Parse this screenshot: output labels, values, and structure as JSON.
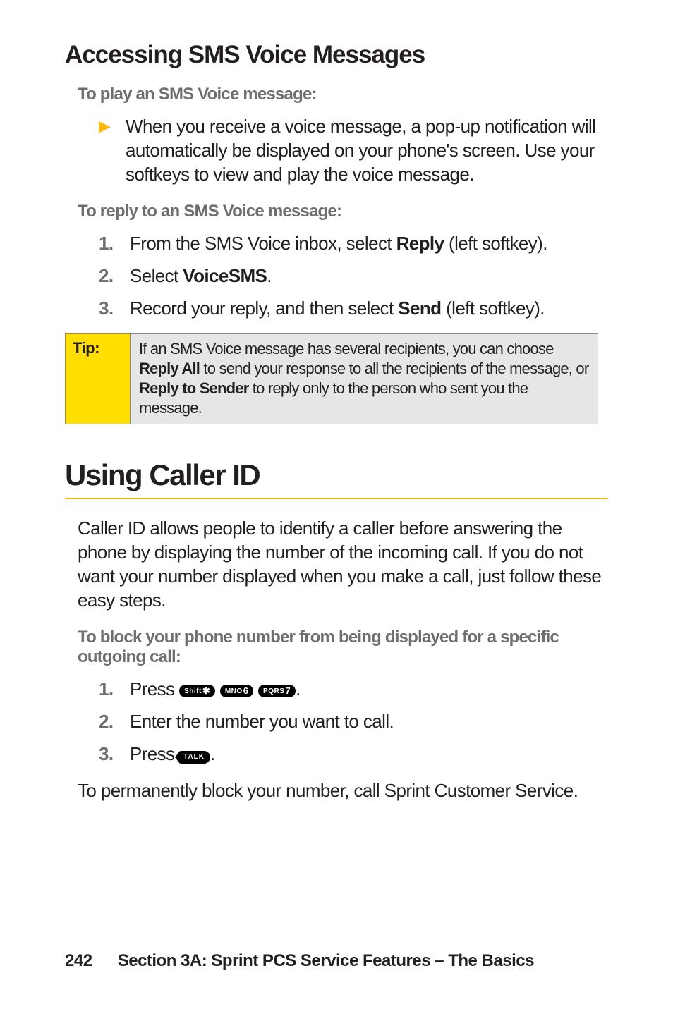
{
  "section1": {
    "heading": "Accessing SMS Voice Messages",
    "lead1": "To play an SMS Voice message:",
    "bullet": "When you receive a voice message, a pop-up notification will automatically be displayed on your phone's screen. Use your softkeys to view and play the voice message.",
    "lead2": "To reply to an SMS Voice message:",
    "step1_pre": "From the SMS Voice inbox, select ",
    "step1_bold": "Reply",
    "step1_post": " (left softkey).",
    "step2_pre": "Select ",
    "step2_bold": "VoiceSMS",
    "step2_post": ".",
    "step3_pre": "Record your reply, and then select ",
    "step3_bold": "Send",
    "step3_post": " (left softkey).",
    "tip_label": "Tip:",
    "tip_pre": "If an SMS Voice message has several recipients, you can choose ",
    "tip_b1": "Reply All",
    "tip_mid": " to send your response to all the recipients of the message, or ",
    "tip_b2": "Reply to Sender",
    "tip_post": " to reply only to the person who sent you the message."
  },
  "section2": {
    "heading": "Using Caller ID",
    "para": "Caller ID allows people to identify a caller before answering the phone by displaying the number of the incoming call. If you do not want your number displayed when you make a call, just follow these easy steps.",
    "lead": "To block your phone number from being displayed for a specific outgoing call:",
    "step1_pre": "Press ",
    "step1_post": ".",
    "step2": "Enter the number you want to call.",
    "step3_pre": "Press ",
    "step3_post": ".",
    "para2": "To permanently block your number, call Sprint Customer Service."
  },
  "keys": {
    "shift_small": "Shift",
    "shift_big": "✱",
    "mno_small": "MNO",
    "mno_big": "6",
    "pqrs_small": "PQRS",
    "pqrs_big": "7",
    "talk": "TALK"
  },
  "nums": {
    "n1": "1.",
    "n2": "2.",
    "n3": "3."
  },
  "footer": {
    "page": "242",
    "text": "Section 3A: Sprint PCS Service Features – The Basics"
  }
}
